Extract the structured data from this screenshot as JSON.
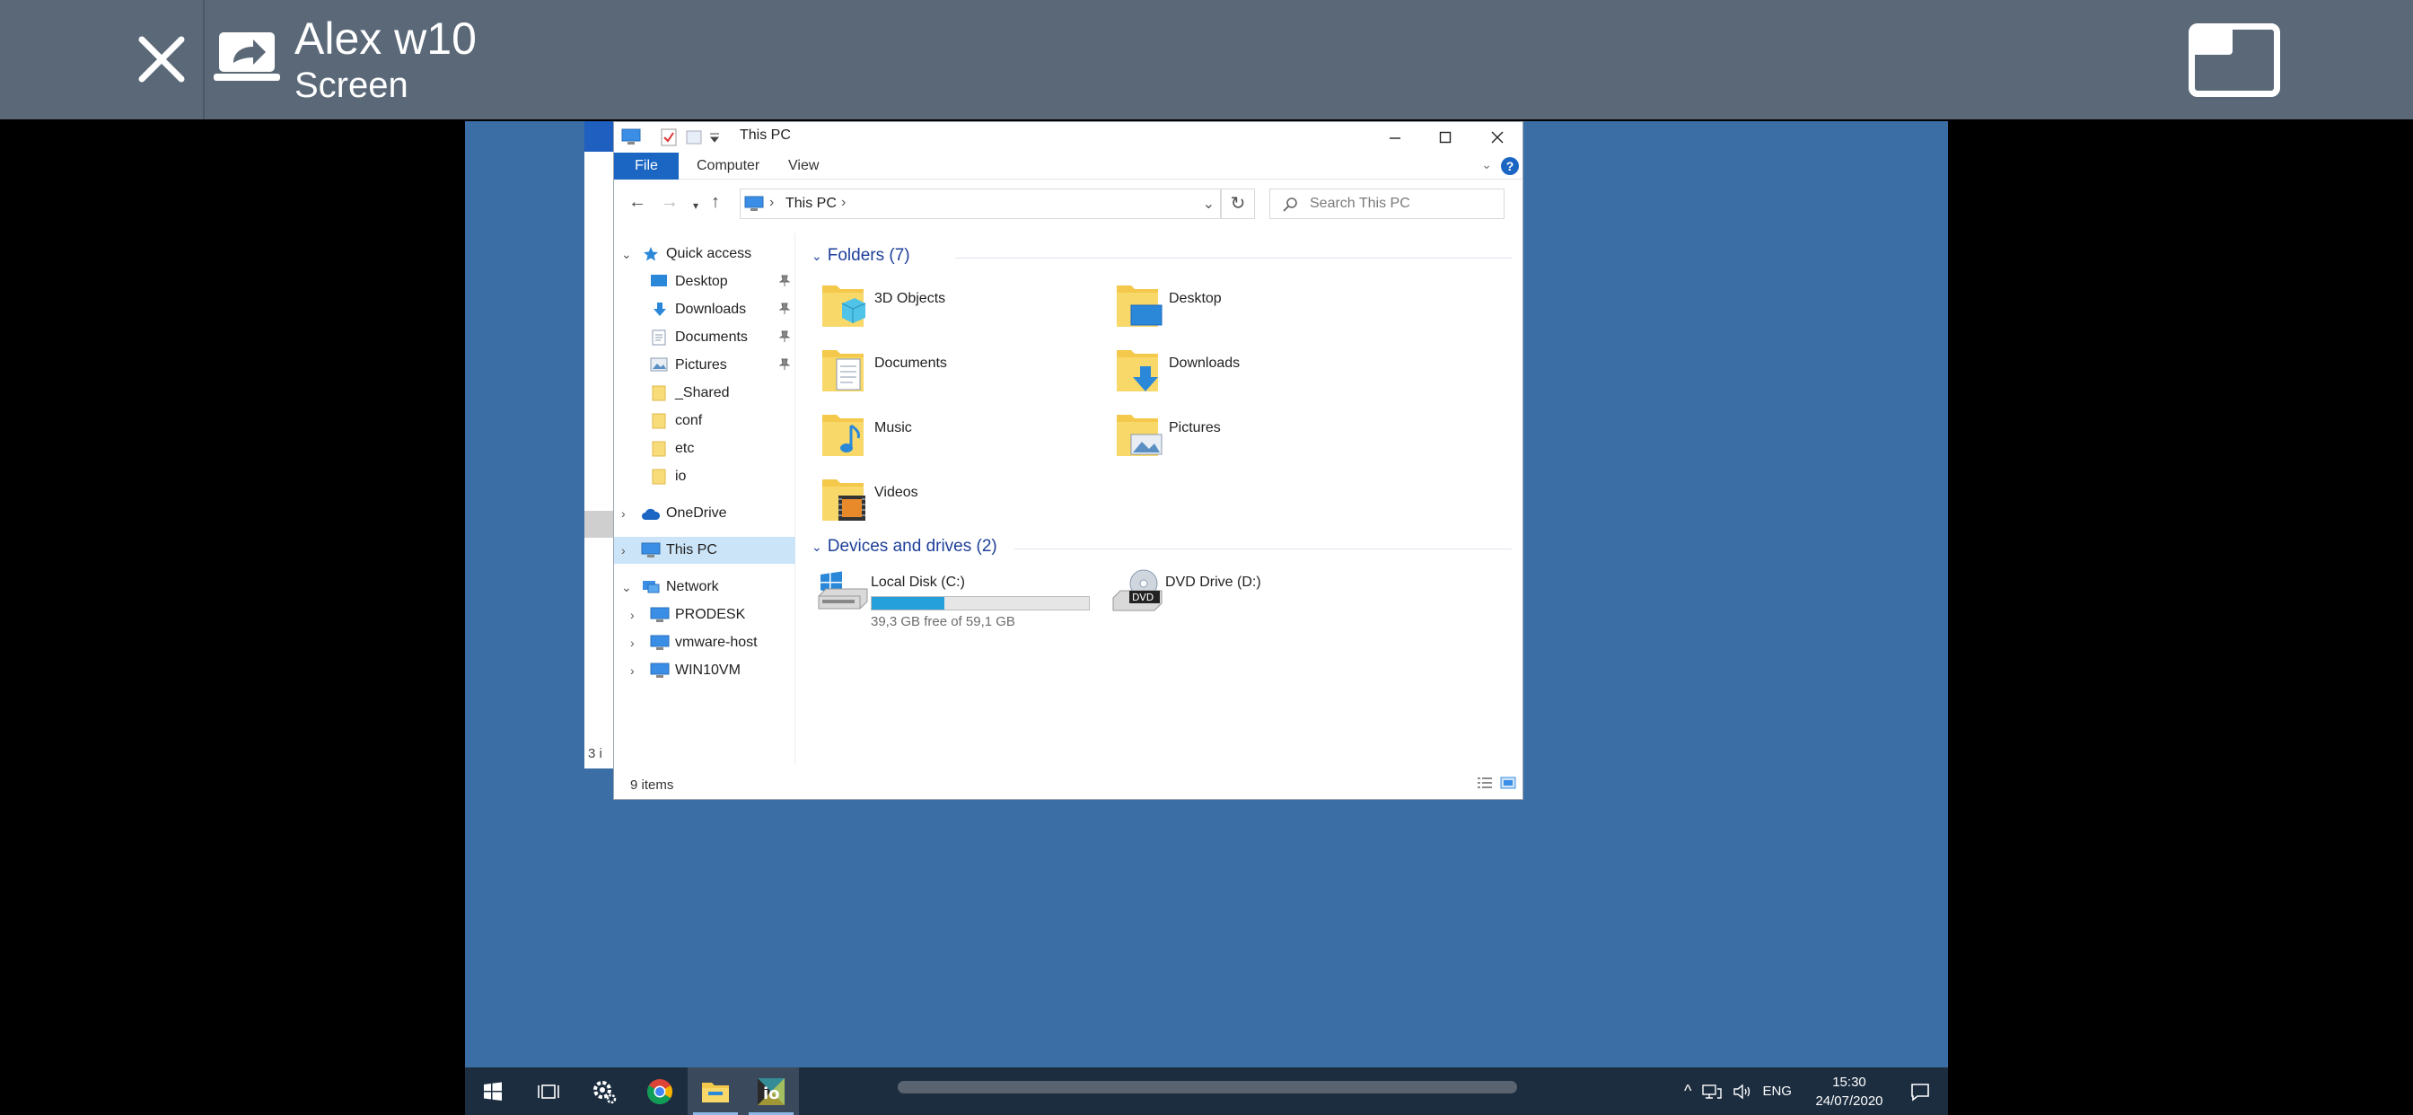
{
  "session": {
    "title": "Alex w10",
    "subtitle": "Screen"
  },
  "explorer": {
    "window_title": "This PC",
    "ribbon_tabs": [
      "File",
      "Computer",
      "View"
    ],
    "address_crumb": "This PC",
    "search_placeholder": "Search This PC",
    "nav": {
      "quick_access": "Quick access",
      "quick_items": [
        "Desktop",
        "Downloads",
        "Documents",
        "Pictures",
        "_Shared",
        "conf",
        "etc",
        "io"
      ],
      "onedrive": "OneDrive",
      "this_pc": "This PC",
      "network": "Network",
      "network_items": [
        "PRODESK",
        "vmware-host",
        "WIN10VM"
      ]
    },
    "folders_header": "Folders (7)",
    "folders": [
      "3D Objects",
      "Desktop",
      "Documents",
      "Downloads",
      "Music",
      "Pictures",
      "Videos"
    ],
    "devices_header": "Devices and drives (2)",
    "drives": [
      {
        "name": "Local Disk (C:)",
        "free_text": "39,3 GB free of 59,1 GB",
        "used_fraction": 0.335
      },
      {
        "name": "DVD Drive (D:)"
      }
    ],
    "status_count": "9 items"
  },
  "background_window": {
    "status_count": "3 i"
  },
  "taskbar": {
    "lang": "ENG",
    "time": "15:30",
    "date": "24/07/2020"
  },
  "colors": {
    "desktop": "#3b6ea5",
    "session_bar": "#5a6878",
    "accent": "#1a66c2",
    "taskbar": "#1c2d40",
    "folder": "#f4c84a"
  }
}
